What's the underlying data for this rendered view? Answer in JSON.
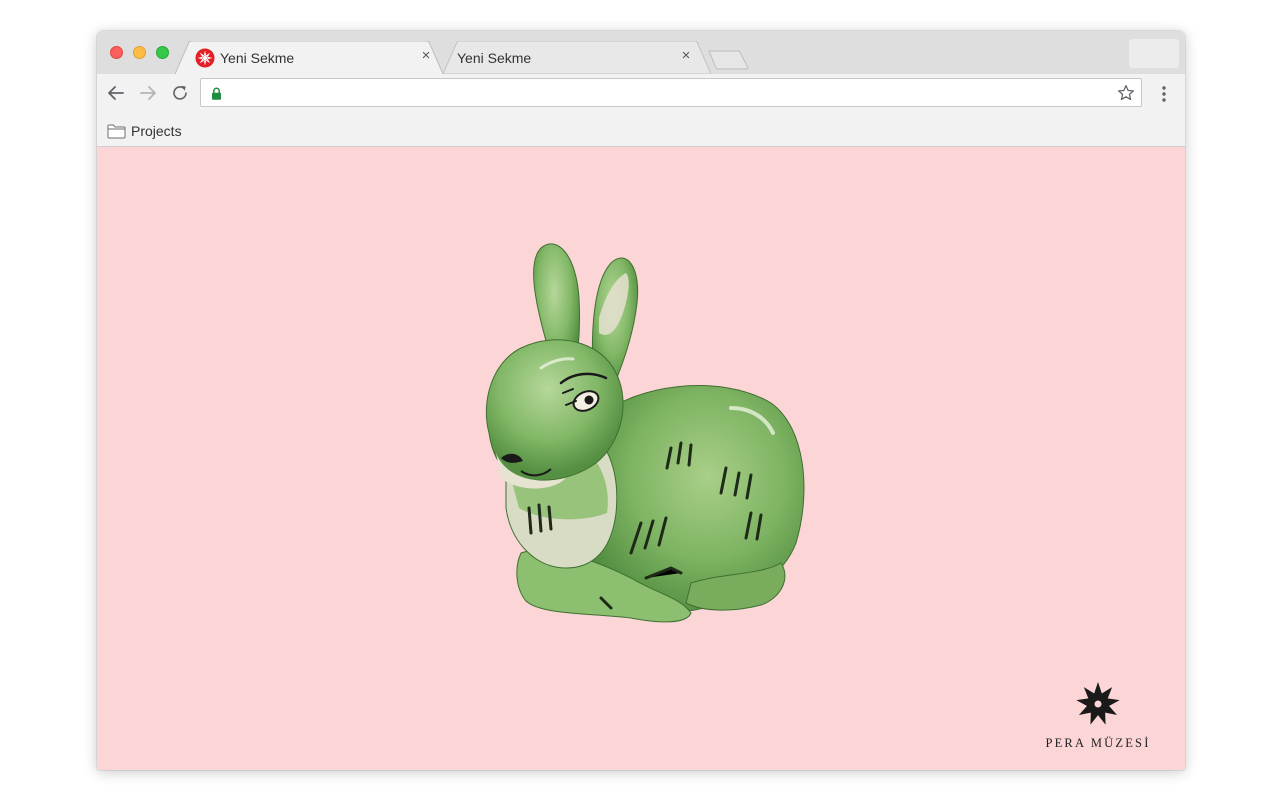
{
  "tabs": [
    {
      "title": "Yeni Sekme",
      "close": "×",
      "active": true
    },
    {
      "title": "Yeni Sekme",
      "close": "×",
      "active": false
    }
  ],
  "toolbar": {
    "back_icon": "arrow-left-icon",
    "forward_icon": "arrow-right-icon",
    "reload_icon": "reload-icon",
    "address_value": "",
    "secure_icon": "lock-icon",
    "bookmark_star_icon": "star-icon",
    "menu_icon": "vertical-dots-icon"
  },
  "bookmarks": [
    {
      "label": "Projects",
      "icon": "folder-icon"
    }
  ],
  "content": {
    "background": "#fcd5d6",
    "image": "green ceramic rabbit figurine",
    "brand": "PERA MÜZESİ"
  },
  "colors": {
    "brand_red": "#e21e26",
    "lock_green": "#1e8e3e"
  }
}
